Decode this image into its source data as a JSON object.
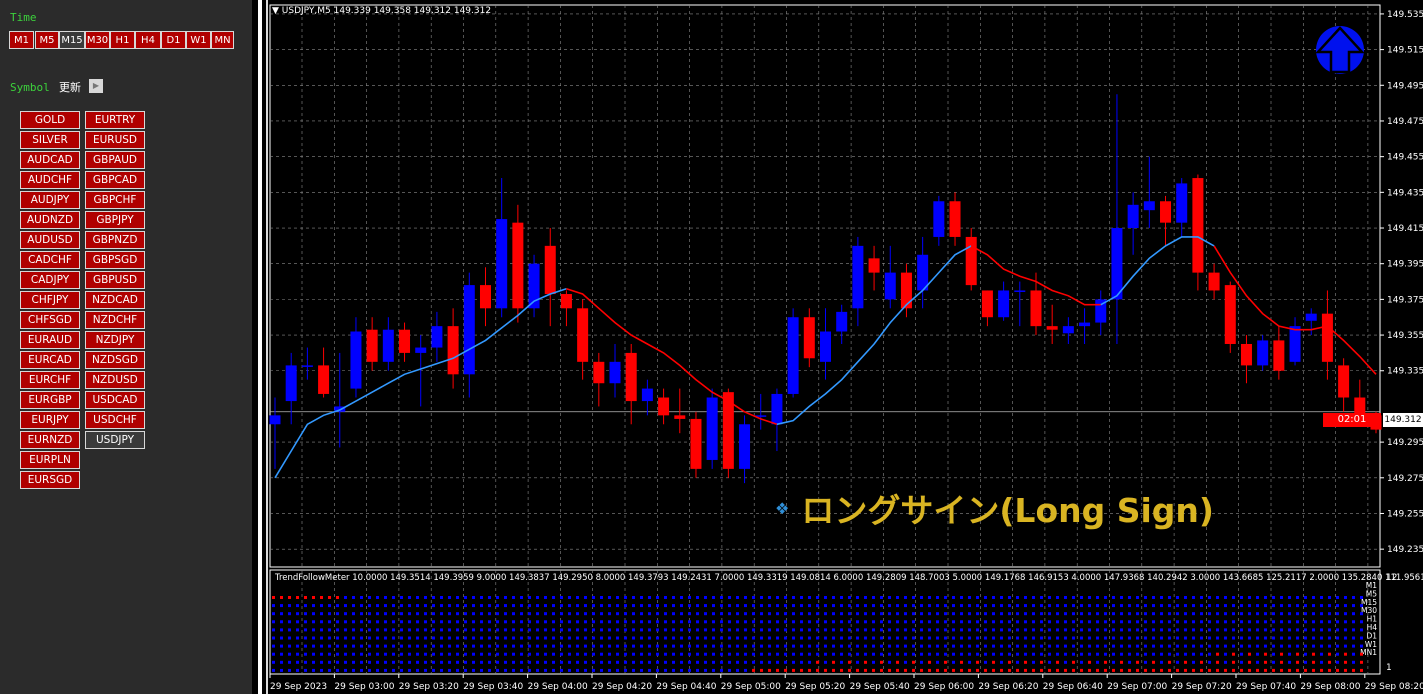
{
  "left_panel": {
    "time_label": "Time",
    "timeframes": [
      "M1",
      "M5",
      "M15",
      "M30",
      "H1",
      "H4",
      "D1",
      "W1",
      "MN"
    ],
    "selected_timeframe": "M15",
    "symbol_label": "Symbol",
    "refresh_label": "更新",
    "symbols_col1": [
      "GOLD",
      "SILVER",
      "AUDCAD",
      "AUDCHF",
      "AUDJPY",
      "AUDNZD",
      "AUDUSD",
      "CADCHF",
      "CADJPY",
      "CHFJPY",
      "CHFSGD",
      "EURAUD",
      "EURCAD",
      "EURCHF",
      "EURGBP",
      "EURJPY",
      "EURNZD",
      "EURPLN",
      "EURSGD"
    ],
    "symbols_col2": [
      "EURTRY",
      "EURUSD",
      "GBPAUD",
      "GBPCAD",
      "GBPCHF",
      "GBPJPY",
      "GBPNZD",
      "GBPSGD",
      "GBPUSD",
      "NZDCAD",
      "NZDCHF",
      "NZDJPY",
      "NZDSGD",
      "NZDUSD",
      "USDCAD",
      "USDCHF",
      "USDJPY"
    ],
    "selected_symbol": "USDJPY"
  },
  "chart": {
    "header": "USDJPY,M5  149.339 149.358 149.312 149.312",
    "price_ticks": [
      "149.535",
      "149.515",
      "149.495",
      "149.475",
      "149.455",
      "149.435",
      "149.415",
      "149.395",
      "149.375",
      "149.355",
      "149.335",
      "149.312",
      "149.295",
      "149.275",
      "149.255",
      "149.235"
    ],
    "time_ticks": [
      "29 Sep 2023",
      "29 Sep 03:00",
      "29 Sep 03:20",
      "29 Sep 03:40",
      "29 Sep 04:00",
      "29 Sep 04:20",
      "29 Sep 04:40",
      "29 Sep 05:00",
      "29 Sep 05:20",
      "29 Sep 05:40",
      "29 Sep 06:00",
      "29 Sep 06:20",
      "29 Sep 06:40",
      "29 Sep 07:00",
      "29 Sep 07:20",
      "29 Sep 07:40",
      "29 Sep 08:00",
      "29 Sep 08:20"
    ],
    "current_price": "149.312",
    "timer": "02:01",
    "signal_text": "ロングサイン(Long Sign)",
    "signal_icon": "diamond-dots-icon",
    "arrow_icon": "up-arrow-icon",
    "colors": {
      "bull": "#0000ff",
      "bear": "#ff0000",
      "ma_up": "#3399ff",
      "ma_down": "#ff0000",
      "signal": "#d9b422"
    }
  },
  "indicator": {
    "header": "TrendFollowMeter 10.0000 149.3514 149.3959 9.0000 149.3837 149.2950 8.0000 149.3793 149.2431 7.0000 149.3319 149.0814 6.0000 149.2809 148.7003 5.0000 149.1768 146.9153 4.0000 147.9368 140.2942 3.0000 143.6685 125.2117 2.0000 135.2840 111.9561",
    "scale_top": "12",
    "scale_bottom": "1",
    "labels": [
      "M1",
      "M5",
      "M15",
      "M30",
      "H1",
      "H4",
      "D1",
      "W1",
      "MN1"
    ]
  },
  "chart_data": {
    "type": "candlestick",
    "symbol": "USDJPY",
    "timeframe": "M5",
    "ylim": [
      149.225,
      149.54
    ],
    "candles": [
      {
        "o": 149.305,
        "h": 149.32,
        "l": 149.28,
        "c": 149.31
      },
      {
        "o": 149.318,
        "h": 149.345,
        "l": 149.305,
        "c": 149.338
      },
      {
        "o": 149.338,
        "h": 149.348,
        "l": 149.33,
        "c": 149.338
      },
      {
        "o": 149.338,
        "h": 149.348,
        "l": 149.32,
        "c": 149.322
      },
      {
        "o": 149.312,
        "h": 149.345,
        "l": 149.292,
        "c": 149.315
      },
      {
        "o": 149.325,
        "h": 149.365,
        "l": 149.32,
        "c": 149.357
      },
      {
        "o": 149.358,
        "h": 149.365,
        "l": 149.335,
        "c": 149.34
      },
      {
        "o": 149.34,
        "h": 149.365,
        "l": 149.335,
        "c": 149.358
      },
      {
        "o": 149.358,
        "h": 149.362,
        "l": 149.34,
        "c": 149.345
      },
      {
        "o": 149.345,
        "h": 149.355,
        "l": 149.315,
        "c": 149.348
      },
      {
        "o": 149.348,
        "h": 149.368,
        "l": 149.34,
        "c": 149.36
      },
      {
        "o": 149.36,
        "h": 149.37,
        "l": 149.325,
        "c": 149.333
      },
      {
        "o": 149.333,
        "h": 149.39,
        "l": 149.32,
        "c": 149.383
      },
      {
        "o": 149.383,
        "h": 149.393,
        "l": 149.36,
        "c": 149.37
      },
      {
        "o": 149.37,
        "h": 149.443,
        "l": 149.365,
        "c": 149.42
      },
      {
        "o": 149.418,
        "h": 149.428,
        "l": 149.362,
        "c": 149.37
      },
      {
        "o": 149.37,
        "h": 149.4,
        "l": 149.365,
        "c": 149.395
      },
      {
        "o": 149.405,
        "h": 149.415,
        "l": 149.36,
        "c": 149.378
      },
      {
        "o": 149.378,
        "h": 149.38,
        "l": 149.36,
        "c": 149.37
      },
      {
        "o": 149.37,
        "h": 149.375,
        "l": 149.33,
        "c": 149.34
      },
      {
        "o": 149.34,
        "h": 149.345,
        "l": 149.315,
        "c": 149.328
      },
      {
        "o": 149.328,
        "h": 149.35,
        "l": 149.32,
        "c": 149.34
      },
      {
        "o": 149.345,
        "h": 149.35,
        "l": 149.305,
        "c": 149.318
      },
      {
        "o": 149.318,
        "h": 149.33,
        "l": 149.31,
        "c": 149.325
      },
      {
        "o": 149.32,
        "h": 149.325,
        "l": 149.305,
        "c": 149.31
      },
      {
        "o": 149.31,
        "h": 149.325,
        "l": 149.3,
        "c": 149.308
      },
      {
        "o": 149.308,
        "h": 149.312,
        "l": 149.275,
        "c": 149.28
      },
      {
        "o": 149.285,
        "h": 149.325,
        "l": 149.28,
        "c": 149.32
      },
      {
        "o": 149.323,
        "h": 149.325,
        "l": 149.275,
        "c": 149.28
      },
      {
        "o": 149.28,
        "h": 149.31,
        "l": 149.272,
        "c": 149.305
      },
      {
        "o": 149.31,
        "h": 149.322,
        "l": 149.302,
        "c": 149.31
      },
      {
        "o": 149.305,
        "h": 149.325,
        "l": 149.29,
        "c": 149.322
      },
      {
        "o": 149.322,
        "h": 149.37,
        "l": 149.32,
        "c": 149.365
      },
      {
        "o": 149.365,
        "h": 149.37,
        "l": 149.337,
        "c": 149.342
      },
      {
        "o": 149.34,
        "h": 149.37,
        "l": 149.33,
        "c": 149.357
      },
      {
        "o": 149.357,
        "h": 149.372,
        "l": 149.35,
        "c": 149.368
      },
      {
        "o": 149.37,
        "h": 149.41,
        "l": 149.36,
        "c": 149.405
      },
      {
        "o": 149.398,
        "h": 149.405,
        "l": 149.38,
        "c": 149.39
      },
      {
        "o": 149.375,
        "h": 149.405,
        "l": 149.37,
        "c": 149.39
      },
      {
        "o": 149.39,
        "h": 149.395,
        "l": 149.365,
        "c": 149.37
      },
      {
        "o": 149.38,
        "h": 149.41,
        "l": 149.37,
        "c": 149.4
      },
      {
        "o": 149.41,
        "h": 149.433,
        "l": 149.405,
        "c": 149.43
      },
      {
        "o": 149.43,
        "h": 149.435,
        "l": 149.405,
        "c": 149.41
      },
      {
        "o": 149.41,
        "h": 149.415,
        "l": 149.38,
        "c": 149.383
      },
      {
        "o": 149.38,
        "h": 149.38,
        "l": 149.36,
        "c": 149.365
      },
      {
        "o": 149.365,
        "h": 149.385,
        "l": 149.363,
        "c": 149.38
      },
      {
        "o": 149.38,
        "h": 149.385,
        "l": 149.36,
        "c": 149.38
      },
      {
        "o": 149.38,
        "h": 149.39,
        "l": 149.355,
        "c": 149.36
      },
      {
        "o": 149.36,
        "h": 149.372,
        "l": 149.35,
        "c": 149.358
      },
      {
        "o": 149.356,
        "h": 149.365,
        "l": 149.35,
        "c": 149.36
      },
      {
        "o": 149.36,
        "h": 149.37,
        "l": 149.35,
        "c": 149.362
      },
      {
        "o": 149.362,
        "h": 149.38,
        "l": 149.355,
        "c": 149.375
      },
      {
        "o": 149.375,
        "h": 149.49,
        "l": 149.35,
        "c": 149.415
      },
      {
        "o": 149.415,
        "h": 149.435,
        "l": 149.4,
        "c": 149.428
      },
      {
        "o": 149.425,
        "h": 149.455,
        "l": 149.415,
        "c": 149.43
      },
      {
        "o": 149.43,
        "h": 149.433,
        "l": 149.405,
        "c": 149.418
      },
      {
        "o": 149.418,
        "h": 149.443,
        "l": 149.41,
        "c": 149.44
      },
      {
        "o": 149.443,
        "h": 149.445,
        "l": 149.38,
        "c": 149.39
      },
      {
        "o": 149.39,
        "h": 149.395,
        "l": 149.375,
        "c": 149.38
      },
      {
        "o": 149.383,
        "h": 149.385,
        "l": 149.345,
        "c": 149.35
      },
      {
        "o": 149.35,
        "h": 149.355,
        "l": 149.328,
        "c": 149.338
      },
      {
        "o": 149.338,
        "h": 149.355,
        "l": 149.335,
        "c": 149.352
      },
      {
        "o": 149.352,
        "h": 149.36,
        "l": 149.33,
        "c": 149.335
      },
      {
        "o": 149.34,
        "h": 149.365,
        "l": 149.338,
        "c": 149.36
      },
      {
        "o": 149.363,
        "h": 149.37,
        "l": 149.355,
        "c": 149.367
      },
      {
        "o": 149.367,
        "h": 149.38,
        "l": 149.33,
        "c": 149.34
      },
      {
        "o": 149.338,
        "h": 149.342,
        "l": 149.312,
        "c": 149.32
      },
      {
        "o": 149.32,
        "h": 149.33,
        "l": 149.305,
        "c": 149.31
      },
      {
        "o": 149.31,
        "h": 149.312,
        "l": 149.3,
        "c": 149.302
      }
    ],
    "ma": [
      149.275,
      149.29,
      149.305,
      149.31,
      149.313,
      149.318,
      149.323,
      149.328,
      149.333,
      149.336,
      149.339,
      149.342,
      149.347,
      149.352,
      149.359,
      149.366,
      149.374,
      149.378,
      149.381,
      149.378,
      149.37,
      149.362,
      149.355,
      149.35,
      149.345,
      149.338,
      149.33,
      149.323,
      149.318,
      149.312,
      149.308,
      149.305,
      149.307,
      149.315,
      149.322,
      149.33,
      149.34,
      149.35,
      149.362,
      149.372,
      149.38,
      149.39,
      149.4,
      149.405,
      149.4,
      149.392,
      149.388,
      149.385,
      149.38,
      149.377,
      149.372,
      149.372,
      149.377,
      149.388,
      149.398,
      149.405,
      149.41,
      149.41,
      149.405,
      149.39,
      149.377,
      149.367,
      149.36,
      149.358,
      149.358,
      149.36,
      149.352,
      149.343,
      149.333
    ],
    "ma_color_switch": [
      [
        0,
        18,
        "up"
      ],
      [
        18,
        31,
        "down"
      ],
      [
        31,
        43,
        "up"
      ],
      [
        43,
        51,
        "down"
      ],
      [
        51,
        58,
        "up"
      ],
      [
        58,
        69,
        "down"
      ]
    ]
  }
}
